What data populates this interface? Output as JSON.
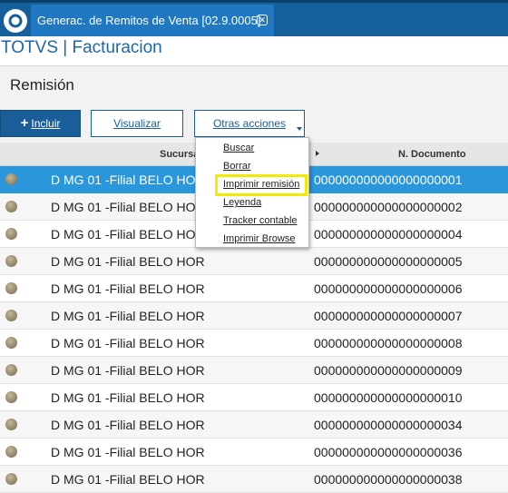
{
  "window": {
    "tab_title": "Generac. de Remitos de Venta [02.9.0005]",
    "close_glyph": "✕",
    "logo_icon": "totvs-logo-icon"
  },
  "app": {
    "title": "TOTVS | Facturacion"
  },
  "section": {
    "title": "Remisión"
  },
  "toolbar": {
    "include_label": "Incluir",
    "include_icon": "+",
    "view_label": "Visualizar",
    "other_actions_label": "Otras acciones"
  },
  "grid": {
    "columns": [
      "Sucursal",
      "N. Documento"
    ],
    "rows": [
      {
        "sucursal": "D MG 01 -Filial BELO HOR",
        "documento": "000000000000000000001",
        "selected": true
      },
      {
        "sucursal": "D MG 01 -Filial BELO HOR",
        "documento": "000000000000000000002"
      },
      {
        "sucursal": "D MG 01 -Filial BELO HOR",
        "documento": "000000000000000000004"
      },
      {
        "sucursal": "D MG 01 -Filial BELO HOR",
        "documento": "000000000000000000005"
      },
      {
        "sucursal": "D MG 01 -Filial BELO HOR",
        "documento": "000000000000000000006"
      },
      {
        "sucursal": "D MG 01 -Filial BELO HOR",
        "documento": "000000000000000000007"
      },
      {
        "sucursal": "D MG 01 -Filial BELO HOR",
        "documento": "000000000000000000008"
      },
      {
        "sucursal": "D MG 01 -Filial BELO HOR",
        "documento": "000000000000000000009"
      },
      {
        "sucursal": "D MG 01 -Filial BELO HOR",
        "documento": "000000000000000000010"
      },
      {
        "sucursal": "D MG 01 -Filial BELO HOR",
        "documento": "000000000000000000034"
      },
      {
        "sucursal": "D MG 01 -Filial BELO HOR",
        "documento": "000000000000000000036"
      },
      {
        "sucursal": "D MG 01 -Filial BELO HOR",
        "documento": "000000000000000000038"
      }
    ]
  },
  "dropdown_menu": {
    "items": [
      "Buscar",
      "Borrar",
      "Imprimir remisión",
      "Leyenda",
      "Tracker contable",
      "Imprimir Browse"
    ],
    "highlighted": "Imprimir remisión"
  },
  "colors": {
    "topbar": "#15609a",
    "tab": "#1f78c1",
    "accent": "#1a5e99",
    "selected_row": "#2a96dc",
    "highlight_box": "#f2ea00"
  }
}
